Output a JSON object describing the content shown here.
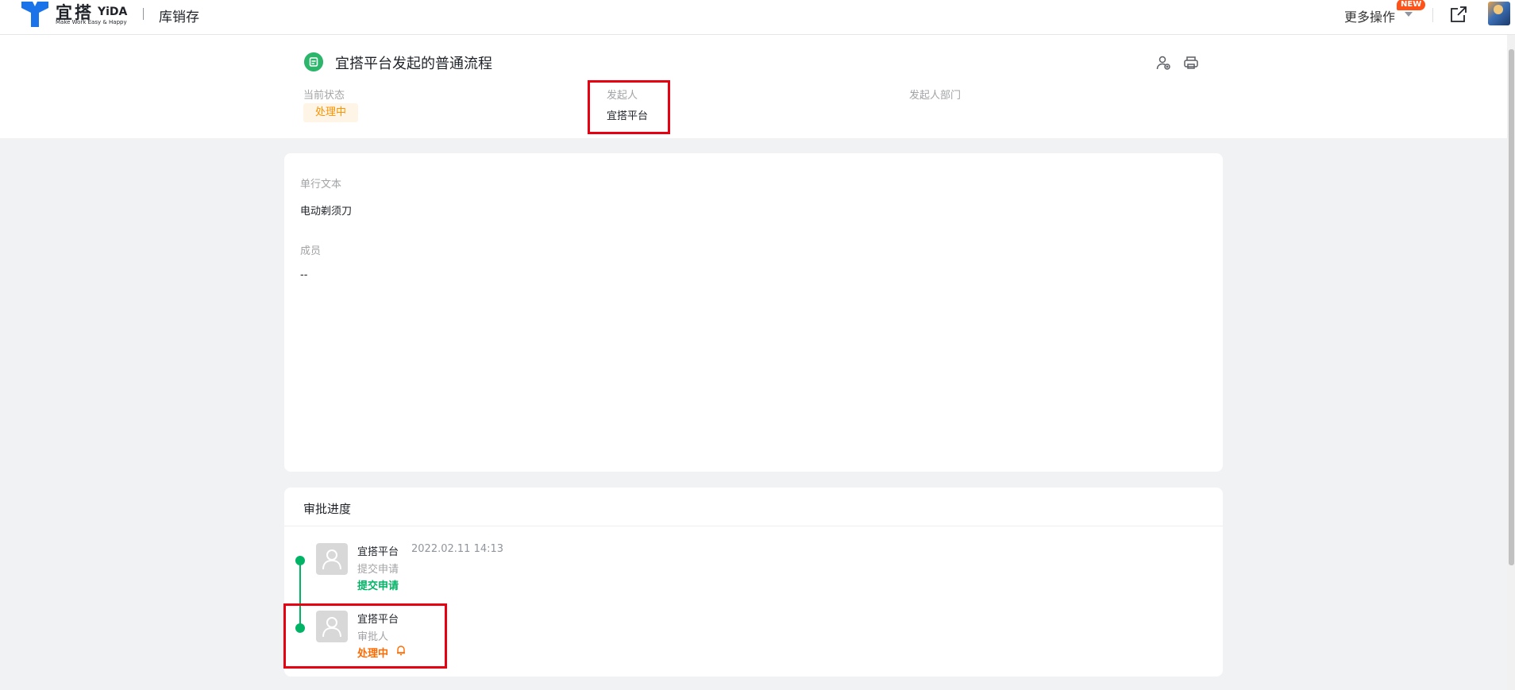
{
  "topbar": {
    "logo_cn": "宜搭",
    "logo_en": "YiDA",
    "logo_slogan": "Make Work Easy & Happy",
    "app_name": "库销存",
    "more_ops": "更多操作",
    "new_badge": "NEW",
    "icons": [
      "yida-logo-icon",
      "chevron-down-icon",
      "external-link-icon",
      "avatar"
    ]
  },
  "header": {
    "title": "宜搭平台发起的普通流程",
    "status_label": "当前状态",
    "status_value": "处理中",
    "initiator_label": "发起人",
    "initiator_value": "宜搭平台",
    "dept_label": "发起人部门",
    "icons": [
      "process-icon",
      "add-user-icon",
      "print-icon"
    ]
  },
  "form": {
    "fields": [
      {
        "label": "单行文本",
        "value": "电动剃须刀"
      },
      {
        "label": "成员",
        "value": "--"
      }
    ]
  },
  "approval": {
    "title": "审批进度",
    "nodes": [
      {
        "name": "宜搭平台",
        "time": "2022.02.11 14:13",
        "sub": "提交申请",
        "result": "提交申请"
      },
      {
        "name": "宜搭平台",
        "time": "",
        "sub": "审批人",
        "result": "处理中"
      }
    ]
  },
  "colors": {
    "accent_green": "#00b365",
    "status_orange": "#ff9200",
    "highlight_red": "#e60012",
    "logo_blue": "#1a73e8"
  }
}
